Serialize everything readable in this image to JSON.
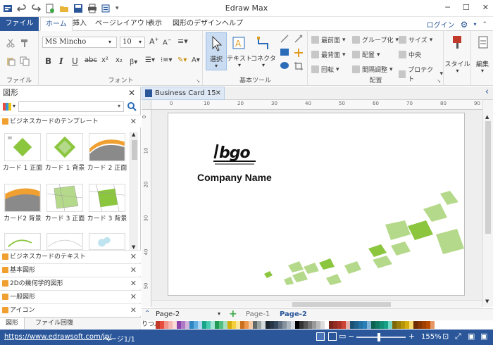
{
  "app": {
    "title": "Edraw Max"
  },
  "quick_access": [
    "app-icon",
    "undo-icon",
    "redo-icon",
    "new-icon",
    "open-icon",
    "save-icon",
    "print-icon",
    "export-icon",
    "customize-icon"
  ],
  "window": {
    "minimize": "─",
    "restore": "☐",
    "close": "✕"
  },
  "tabs": [
    "ファイル",
    "ホーム",
    "挿入",
    "ページレイアウト",
    "表示",
    "図形のデザイン",
    "ヘルプ"
  ],
  "tabs_right": {
    "login": "ログイン"
  },
  "ribbon": {
    "file_group": {
      "label": "ファイル"
    },
    "font_group": {
      "label": "フォント",
      "font_name": "MS Mincho",
      "font_size": "10"
    },
    "basic_tools": {
      "label": "基本ツール",
      "select": "選択",
      "text": "テキスト",
      "connector": "コネクタ"
    },
    "arrange": {
      "label": "配置",
      "bring_front": "最前面",
      "send_back": "最背面",
      "rotate": "回転",
      "group": "グループ化",
      "align": "配置",
      "spacing": "間隔調整",
      "size": "サイズ",
      "center": "中央",
      "protect": "プロテクト"
    },
    "style": {
      "label": "スタイル"
    },
    "edit": {
      "label": "編集"
    }
  },
  "left_panel": {
    "title": "図形",
    "search_placeholder": "",
    "categories_open": "ビジネスカードのテンプレート",
    "thumbs": [
      "カード 1 正面",
      "カード 1 背景",
      "カード 2 正面",
      "カード2 背景",
      "カード 3 正面",
      "カード 3 背景"
    ],
    "categories": [
      "ビジネスカードのテキスト",
      "基本図形",
      "2Dの幾何学的図形",
      "一般図形",
      "アイコン"
    ],
    "bottom_tabs": [
      "図形",
      "ファイル回復"
    ]
  },
  "document": {
    "tab_name": "Business Card 15",
    "ruler_top": [
      "0",
      "10",
      "20",
      "30",
      "40",
      "50",
      "60",
      "70",
      "80",
      "90"
    ],
    "ruler_left": [
      "0",
      "10",
      "20",
      "30",
      "40",
      "50"
    ],
    "card": {
      "logo": "bgo",
      "company": "Company Name"
    }
  },
  "pages": {
    "current": "Page-2",
    "list": [
      "Page-1",
      "Page-2"
    ]
  },
  "palette_label": "りつぶ",
  "status": {
    "url": "https://www.edrawsoft.com/jp/",
    "page": "ページ1/1",
    "zoom": "155%"
  },
  "colors": {
    "accent": "#2b579a",
    "green": "#8cc63f",
    "green_light": "#b5d98a"
  }
}
